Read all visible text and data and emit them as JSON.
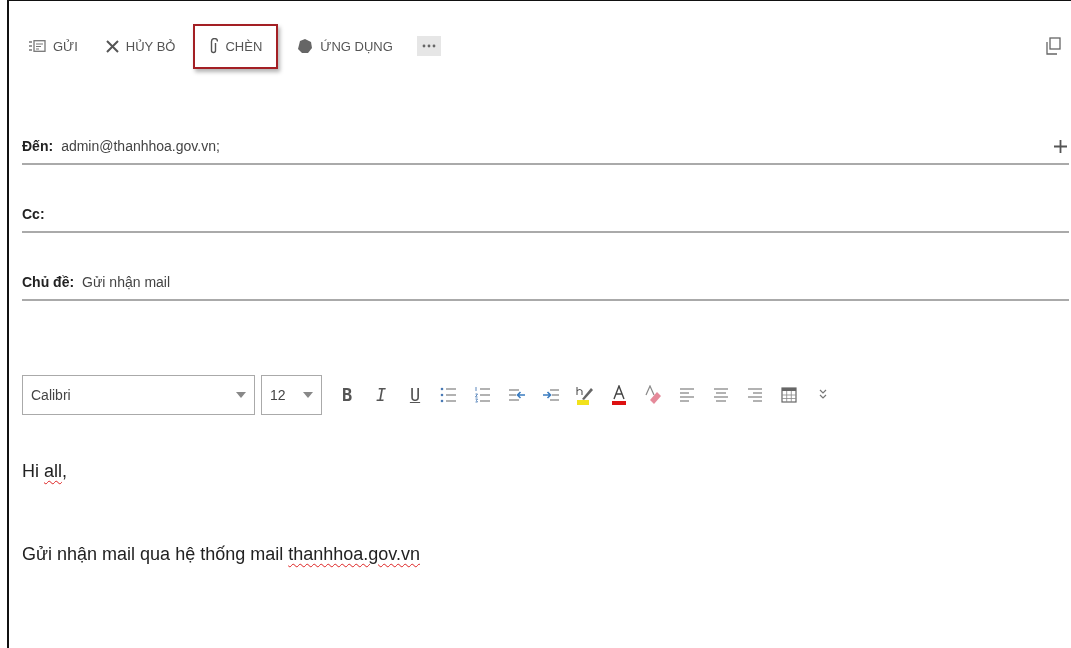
{
  "command_bar": [
    {
      "kind": "send",
      "label": "GỬI",
      "highlighted": false
    },
    {
      "kind": "discard",
      "label": "HỦY BỎ",
      "highlighted": false
    },
    {
      "kind": "attach",
      "label": "CHÈN",
      "highlighted": true
    },
    {
      "kind": "apps",
      "label": "ỨNG DỤNG",
      "highlighted": false
    },
    {
      "kind": "more",
      "highlighted": false
    }
  ],
  "fields": [
    {
      "label": "Đến:",
      "value": "admin@thanhhoa.gov.vn;",
      "add_button": true
    },
    {
      "label": "Cc:",
      "add_button": false
    },
    {
      "label": "Chủ đề:",
      "value": "Gửi nhận mail",
      "add_button": false
    }
  ],
  "format_toolbar": {
    "font": "Calibri",
    "size": "12",
    "buttons": [
      {
        "kind": "bold",
        "label": "B"
      },
      {
        "kind": "italic",
        "label": "I"
      },
      {
        "kind": "underline",
        "label": "U"
      },
      {
        "kind": "bullets"
      },
      {
        "kind": "numbering"
      },
      {
        "kind": "outdent"
      },
      {
        "kind": "indent"
      },
      {
        "kind": "highlight"
      },
      {
        "kind": "font-color"
      },
      {
        "kind": "clear-format"
      },
      {
        "kind": "align-left"
      },
      {
        "kind": "align-center"
      },
      {
        "kind": "align-right"
      },
      {
        "kind": "table"
      },
      {
        "kind": "expand"
      }
    ]
  },
  "body": [
    [
      {
        "text": "Hi "
      },
      {
        "text": "all",
        "misspelled": true
      },
      {
        "text": ","
      }
    ],
    [
      {
        "text": "Gửi nhận mail qua hệ thống mail "
      },
      {
        "text": "thanhhoa.gov.vn",
        "misspelled": true
      }
    ]
  ]
}
